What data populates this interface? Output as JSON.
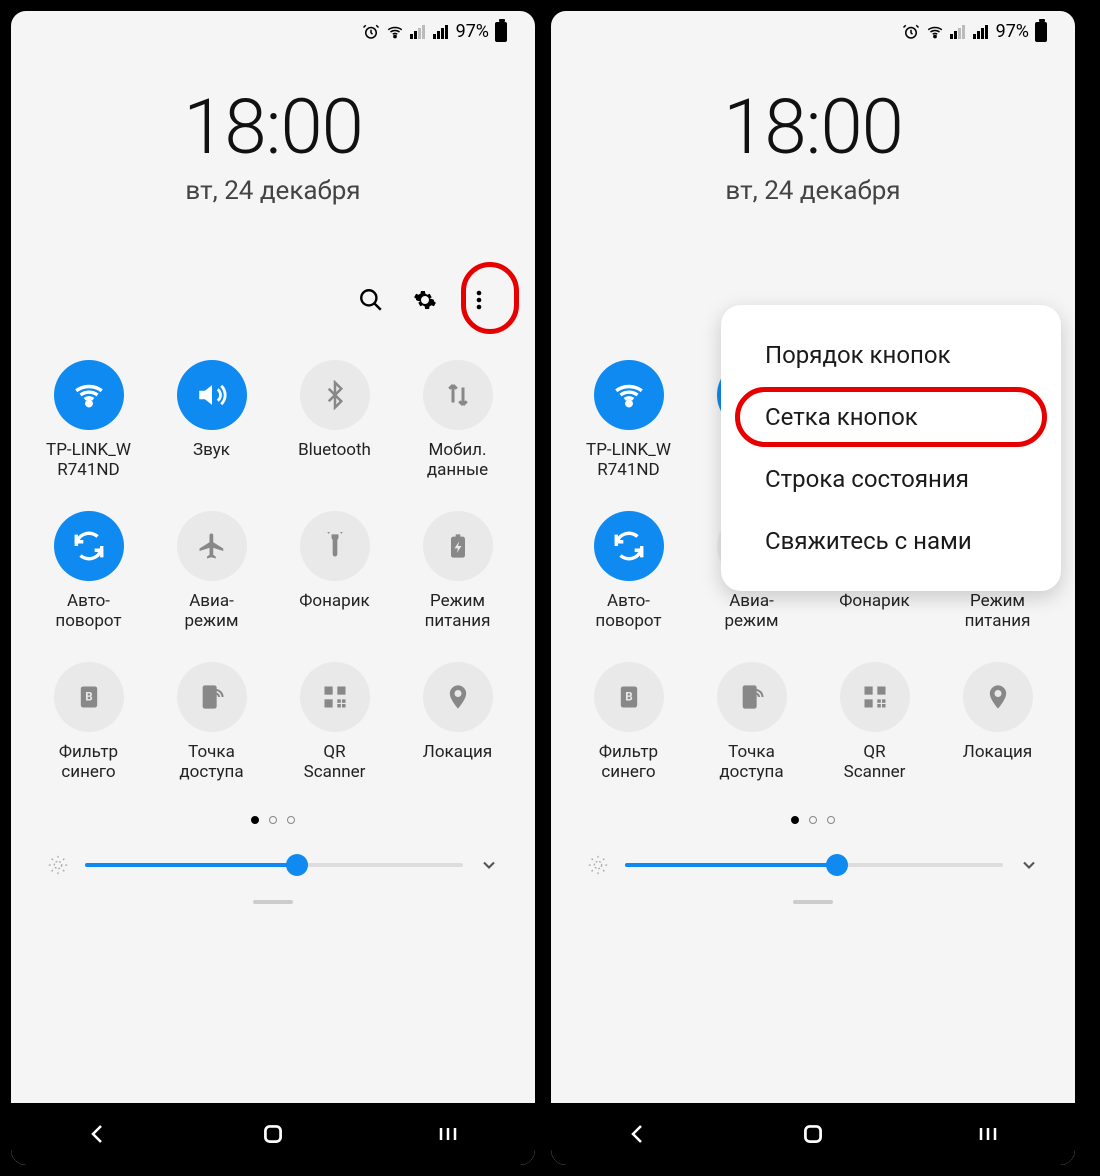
{
  "status": {
    "battery_percent": "97%"
  },
  "time_block": {
    "clock": "18:00",
    "date": "вт, 24 декабря"
  },
  "tiles": [
    {
      "id": "wifi",
      "label": "TP-LINK_W\nR741ND",
      "active": true
    },
    {
      "id": "sound",
      "label": "Звук",
      "active": true
    },
    {
      "id": "bluetooth",
      "label": "Bluetooth",
      "active": false
    },
    {
      "id": "mobiledata",
      "label": "Мобил.\nданные",
      "active": false
    },
    {
      "id": "autorotate",
      "label": "Авто-\nповорот",
      "active": true
    },
    {
      "id": "airplane",
      "label": "Авиа-\nрежим",
      "active": false
    },
    {
      "id": "flashlight",
      "label": "Фонарик",
      "active": false
    },
    {
      "id": "power",
      "label": "Режим\nпитания",
      "active": false
    },
    {
      "id": "bluefilter",
      "label": "Фильтр\nсинего",
      "active": false
    },
    {
      "id": "hotspot",
      "label": "Точка\nдоступа",
      "active": false
    },
    {
      "id": "qr",
      "label": "QR\nScanner",
      "active": false
    },
    {
      "id": "location",
      "label": "Локация",
      "active": false
    }
  ],
  "popup": {
    "items": [
      "Порядок кнопок",
      "Сетка кнопок",
      "Строка состояния",
      "Свяжитесь с нами"
    ],
    "highlight_index": 1
  }
}
